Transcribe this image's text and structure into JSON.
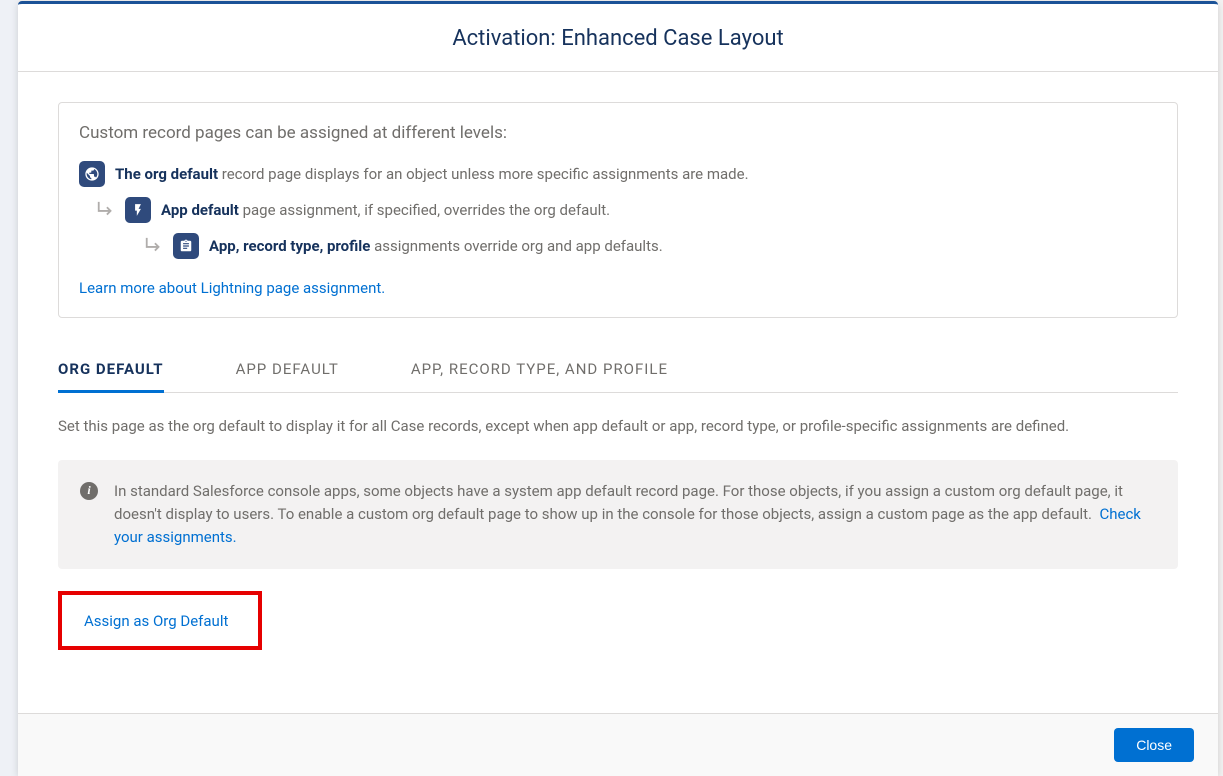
{
  "header": {
    "title": "Activation: Enhanced Case Layout"
  },
  "info": {
    "intro": "Custom record pages can be assigned at different levels:",
    "level1_bold": "The org default",
    "level1_rest": " record page displays for an object unless more specific assignments are made.",
    "level2_bold": "App default",
    "level2_rest": " page assignment, if specified, overrides the org default.",
    "level3_bold": "App, record type, profile",
    "level3_rest": " assignments override org and app defaults.",
    "learn_more": "Learn more about Lightning page assignment."
  },
  "tabs": {
    "org": "ORG DEFAULT",
    "app": "APP DEFAULT",
    "profile": "APP, RECORD TYPE, AND PROFILE"
  },
  "org_tab": {
    "description": "Set this page as the org default to display it for all Case records, except when app default or app, record type, or profile-specific assignments are defined.",
    "note_text": "In standard Salesforce console apps, some objects have a system app default record page. For those objects, if you assign a custom org default page, it doesn't display to users. To enable a custom org default page to show up in the console for those objects, assign a custom page as the app default. ",
    "note_link": "Check your assignments.",
    "assign_button": "Assign as Org Default"
  },
  "footer": {
    "close": "Close"
  }
}
